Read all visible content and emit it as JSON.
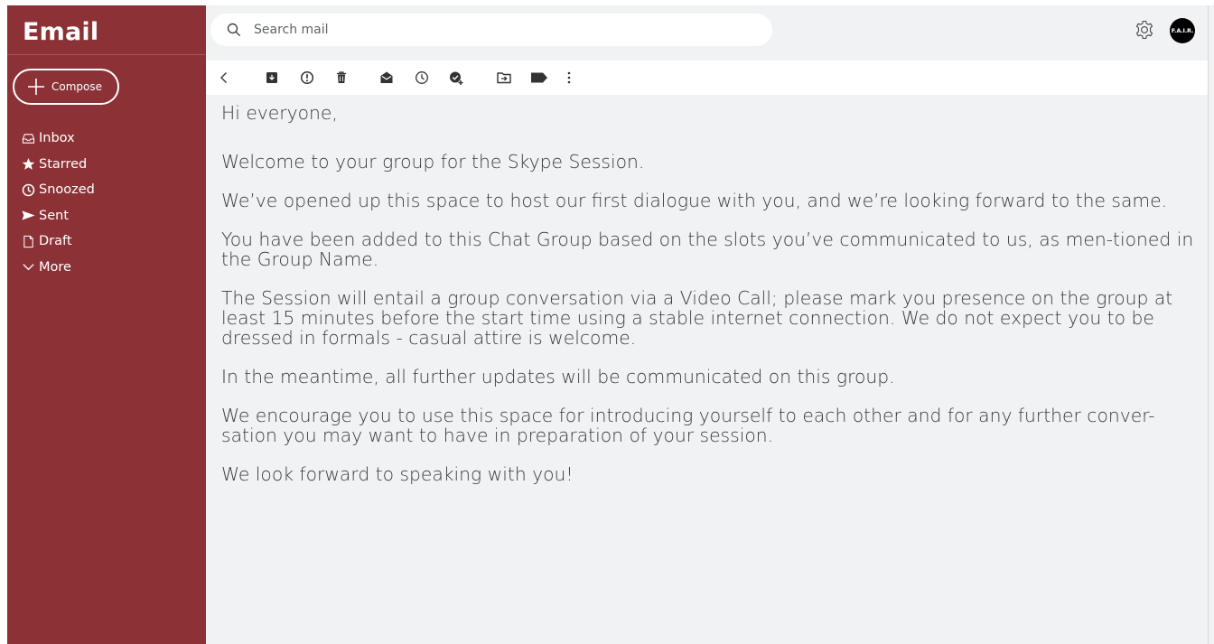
{
  "app": {
    "title": "Email"
  },
  "compose": {
    "label": "Compose"
  },
  "nav": [
    {
      "label": "Inbox",
      "icon": "inbox-icon"
    },
    {
      "label": "Starred",
      "icon": "star-icon"
    },
    {
      "label": "Snoozed",
      "icon": "clock-icon"
    },
    {
      "label": "Sent",
      "icon": "send-icon"
    },
    {
      "label": "Draft",
      "icon": "file-icon"
    },
    {
      "label": "More",
      "icon": "chevron-down-icon"
    }
  ],
  "search": {
    "placeholder": "Search mail"
  },
  "user": {
    "avatar_text": "F.A.I.R."
  },
  "toolbar": {
    "icons": [
      "back-icon",
      "archive-icon",
      "report-spam-icon",
      "delete-icon",
      "mark-unread-icon",
      "snooze-icon",
      "add-task-icon",
      "move-to-icon",
      "label-icon",
      "more-vert-icon"
    ]
  },
  "message": {
    "greeting": "Hi everyone,",
    "paragraphs": [
      "Welcome to your group for the Skype Session.",
      "We’ve opened up this space to host our first dialogue with you, and we’re looking forward to the same.",
      "You have been added to this Chat Group based on the slots you’ve communicated to us, as men-tioned in the Group Name.",
      "The Session will entail a group conversation via a Video Call; please mark you presence on the group at least 15 minutes before the start time using a stable internet connection. We do not expect you to be dressed in formals - casual attire is welcome.",
      "In the meantime, all further updates will be communicated on this group.",
      "We encourage you to use this space for introducing yourself to each other and for any further conver-sation you may want to have in preparation of your session.",
      "We look forward to speaking with you!"
    ]
  },
  "colors": {
    "sidebar": "#8c3236",
    "content_bg": "#f1f2f4"
  }
}
